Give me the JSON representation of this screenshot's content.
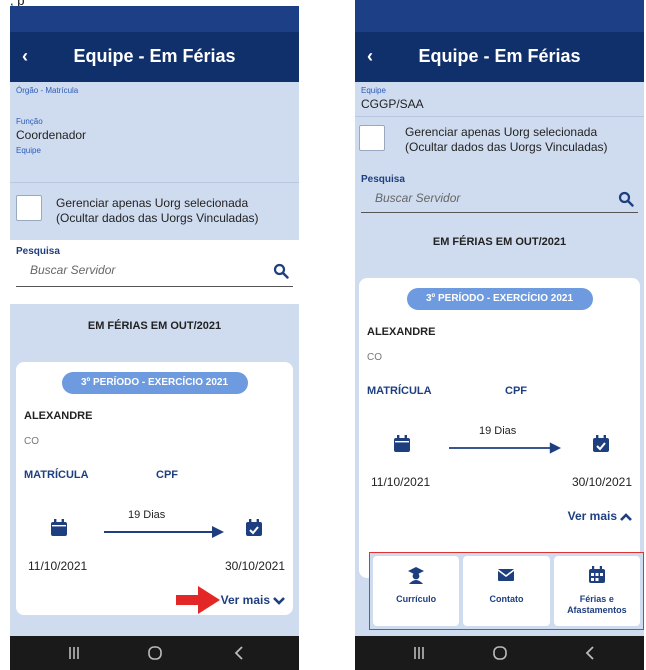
{
  "caption": ", p",
  "app": {
    "title": "Equipe - Em Férias",
    "back": "‹"
  },
  "left": {
    "orgao_label": "Órgão - Matrícula",
    "funcao_label": "Função",
    "funcao_value": "Coordenador",
    "equipe_label": "Equipe"
  },
  "right": {
    "equipe_label": "Equipe",
    "equipe_value": "CGGP/SAA"
  },
  "filter": {
    "checkbox_label": "Gerenciar apenas Uorg selecionada (Ocultar dados das Uorgs Vinculadas)"
  },
  "search": {
    "label": "Pesquisa",
    "placeholder": "Buscar Servidor"
  },
  "section": {
    "title": "EM FÉRIAS EM OUT/2021"
  },
  "card": {
    "badge": "3º PERÍODO - EXERCÍCIO 2021",
    "name": "ALEXANDRE",
    "subtitle": "CO",
    "field1": "MATRÍCULA",
    "field2": "CPF",
    "days": "19 Dias",
    "start_date": "11/10/2021",
    "end_date": "30/10/2021",
    "ver_mais": "Ver mais"
  },
  "actions": [
    {
      "label": "Currículo",
      "icon": "graduate-icon"
    },
    {
      "label": "Contato",
      "icon": "envelope-icon"
    },
    {
      "label": "Férias e Afastamentos",
      "icon": "calendar-icon"
    }
  ],
  "colors": {
    "header": "#10306c",
    "status": "#1d3f86",
    "panel": "#cfdcef",
    "badge": "#6e9bdf",
    "accent": "#1e3f7f",
    "highlight": "#e32626"
  }
}
